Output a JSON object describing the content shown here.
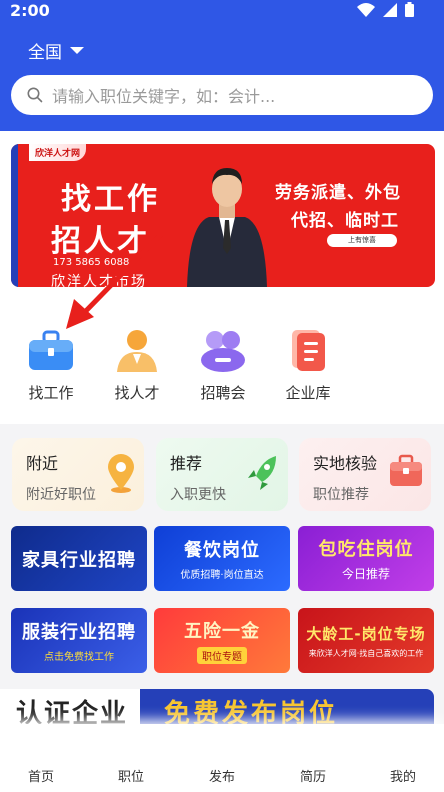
{
  "status": {
    "time": "2:00"
  },
  "header": {
    "region": "全国",
    "search_placeholder": "请输入职位关键字，如：会计..."
  },
  "banner": {
    "brand": "欣洋人才网",
    "headline1": "找工作",
    "headline2": "招人才",
    "phone": "173 5865 6088",
    "market": "欣洋人才市场",
    "right1": "劳务派遣、外包",
    "right2": "代招、临时工",
    "badge": "上有惊喜"
  },
  "categories": [
    {
      "label": "找工作",
      "icon": "briefcase-icon"
    },
    {
      "label": "找人才",
      "icon": "person-icon"
    },
    {
      "label": "招聘会",
      "icon": "meeting-icon"
    },
    {
      "label": "企业库",
      "icon": "document-icon"
    }
  ],
  "features": [
    {
      "title": "附近",
      "subtitle": "附近好职位",
      "icon": "location-pin-icon"
    },
    {
      "title": "推荐",
      "subtitle": "入职更快",
      "icon": "rocket-icon"
    },
    {
      "title": "实地核验",
      "subtitle": "职位推荐",
      "icon": "briefcase-icon"
    }
  ],
  "tiles": [
    {
      "title": "家具行业招聘",
      "sub": ""
    },
    {
      "title": "餐饮岗位",
      "sub": "优质招聘·岗位直达"
    },
    {
      "title": "包吃住岗位",
      "sub": "今日推荐"
    },
    {
      "title": "服装行业招聘",
      "sub": "点击免费找工作"
    },
    {
      "title": "五险一金",
      "sub": "职位专题"
    },
    {
      "title": "大龄工-岗位专场",
      "sub": "来欣洋人才网·找自己喜欢的工作"
    }
  ],
  "promo": {
    "left": "认证企业",
    "right": "免费发布岗位"
  },
  "nav": [
    {
      "label": "首页"
    },
    {
      "label": "职位"
    },
    {
      "label": "发布"
    },
    {
      "label": "简历"
    },
    {
      "label": "我的"
    }
  ],
  "colors": {
    "primary": "#2f57e6",
    "banner_red": "#e8201c",
    "promo_gold": "#f7c531"
  }
}
